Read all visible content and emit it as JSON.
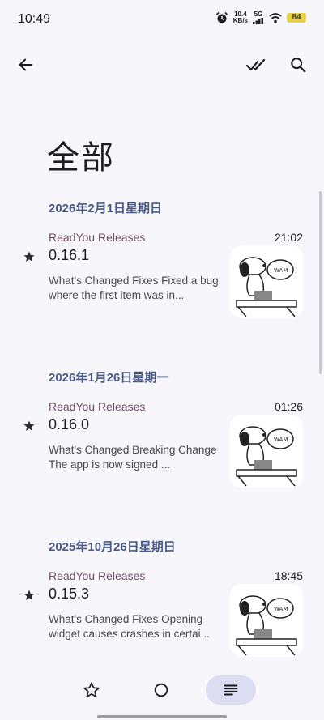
{
  "status_bar": {
    "time": "10:49",
    "net_speed_value": "10.4",
    "net_speed_unit": "KB/s",
    "network": "5G",
    "battery": "84"
  },
  "top_bar": {
    "icons": [
      "back-arrow-icon",
      "mark-all-read-icon",
      "search-icon"
    ]
  },
  "page": {
    "title": "全部"
  },
  "groups": [
    {
      "date": "2026年2月1日星期日",
      "article": {
        "feed": "ReadYou Releases",
        "time": "21:02",
        "title": "0.16.1",
        "description": "What's Changed Fixes Fixed a bug where the first item was in..."
      }
    },
    {
      "date": "2026年1月26日星期一",
      "article": {
        "feed": "ReadYou Releases",
        "time": "01:26",
        "title": "0.16.0",
        "description": "What's Changed Breaking Change The app is now signed ..."
      }
    },
    {
      "date": "2025年10月26日星期日",
      "article": {
        "feed": "ReadYou Releases",
        "time": "18:45",
        "title": "0.15.3",
        "description": "What's Changed Fixes Opening widget causes crashes in certai..."
      }
    }
  ],
  "bottom_nav": {
    "items": [
      "starred-icon",
      "unread-icon",
      "all-icon"
    ],
    "selected": "all"
  },
  "colors": {
    "background": "#f7f6fb",
    "date_header": "#4a5a86",
    "feed_name": "#6f4c66",
    "nav_selected": "#dcdcf3"
  }
}
